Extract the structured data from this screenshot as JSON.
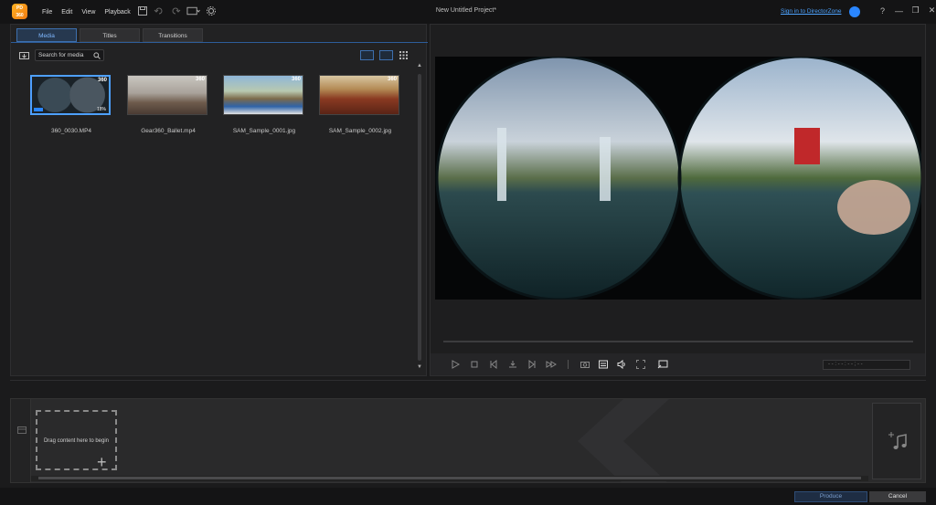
{
  "app": {
    "logo_text": "Power\nDirector",
    "title": "New Untitled Project*"
  },
  "menu": [
    "File",
    "Edit",
    "View",
    "Playback"
  ],
  "account": {
    "signin_label": "Sign in to DirectorZone"
  },
  "window_controls": [
    "?",
    "—",
    "❐",
    "✕"
  ],
  "library": {
    "tabs": [
      {
        "label": "Media",
        "active": true
      },
      {
        "label": "Titles",
        "active": false
      },
      {
        "label": "Transitions",
        "active": false
      }
    ],
    "search": {
      "placeholder": "Search for media"
    },
    "items": [
      {
        "name": "360_0030.MP4",
        "badge": "360",
        "progress_label": "18%",
        "selected": true,
        "icon": "video-thumbnail"
      },
      {
        "name": "Gear360_Ballet.mp4",
        "badge": "360",
        "selected": false,
        "icon": "video-thumbnail"
      },
      {
        "name": "SAM_Sample_0001.jpg",
        "badge": "360",
        "selected": false,
        "icon": "image-thumbnail"
      },
      {
        "name": "SAM_Sample_0002.jpg",
        "badge": "360",
        "selected": false,
        "icon": "image-thumbnail"
      }
    ]
  },
  "preview": {
    "timecode": "- - : - - : - - ; - -",
    "controls": [
      "play-icon",
      "stop-icon",
      "previous-frame-icon",
      "split-icon",
      "next-frame-icon",
      "fast-forward-icon",
      "snapshot-icon",
      "subtitle-icon",
      "volume-icon",
      "fullscreen-icon",
      "external-display-icon"
    ]
  },
  "timeline": {
    "dropzone_text": "Drag content here to begin",
    "music_icon": "music-note-icon"
  },
  "footer": {
    "produce_label": "Produce",
    "cancel_label": "Cancel"
  }
}
